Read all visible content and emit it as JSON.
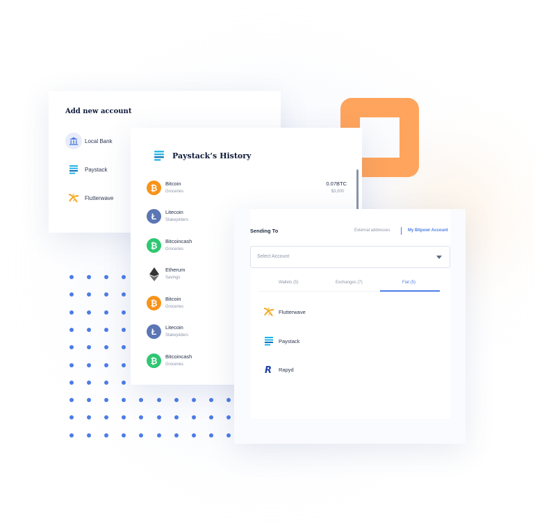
{
  "add_account": {
    "title": "Add new account",
    "items": [
      {
        "label": "Local Bank",
        "icon": "bank-icon"
      },
      {
        "label": "Paystack",
        "icon": "paystack-icon"
      },
      {
        "label": "Flutterwave",
        "icon": "flutterwave-icon"
      }
    ]
  },
  "history": {
    "title": "Paystack’s History",
    "transactions": [
      {
        "name": "Bitcoin",
        "category": "Groceries",
        "amount": "0.07BTC",
        "fiat": "$3,000",
        "icon": "bitcoin-icon",
        "color": "#f7931a"
      },
      {
        "name": "Litecoin",
        "category": "Stakejolders",
        "icon": "litecoin-icon",
        "color": "#5b76b4"
      },
      {
        "name": "Bitcoincash",
        "category": "Groceries",
        "icon": "bitcoincash-icon",
        "color": "#2ec772"
      },
      {
        "name": "Etherum",
        "category": "Savings",
        "icon": "ethereum-icon",
        "color": "#343434"
      },
      {
        "name": "Bitcoin",
        "category": "Groceries",
        "icon": "bitcoin-icon",
        "color": "#f7931a"
      },
      {
        "name": "Litecoin",
        "category": "Stakejolders",
        "icon": "litecoin-icon",
        "color": "#5b76b4"
      },
      {
        "name": "Bitcoincash",
        "category": "Groceries",
        "icon": "bitcoincash-icon",
        "color": "#2ec772"
      }
    ]
  },
  "sending": {
    "title": "Sending To",
    "tab_external": "External addresses",
    "tab_my_account": "My Bitpowr Account",
    "select_placeholder": "Select Account",
    "tabs": [
      "Wallets (5)",
      "Exchanges (7)",
      "Fiat (5)"
    ],
    "active_tab": "Fiat (5)",
    "providers": [
      {
        "label": "Flutterwave",
        "icon": "flutterwave-icon"
      },
      {
        "label": "Paystack",
        "icon": "paystack-icon"
      },
      {
        "label": "Rapyd",
        "icon": "rapyd-icon"
      }
    ]
  },
  "colors": {
    "accent": "#4c7ce6",
    "orange": "#ffa45c",
    "paystack": "#1fb3e8",
    "flutterwave": "#f5a623"
  }
}
